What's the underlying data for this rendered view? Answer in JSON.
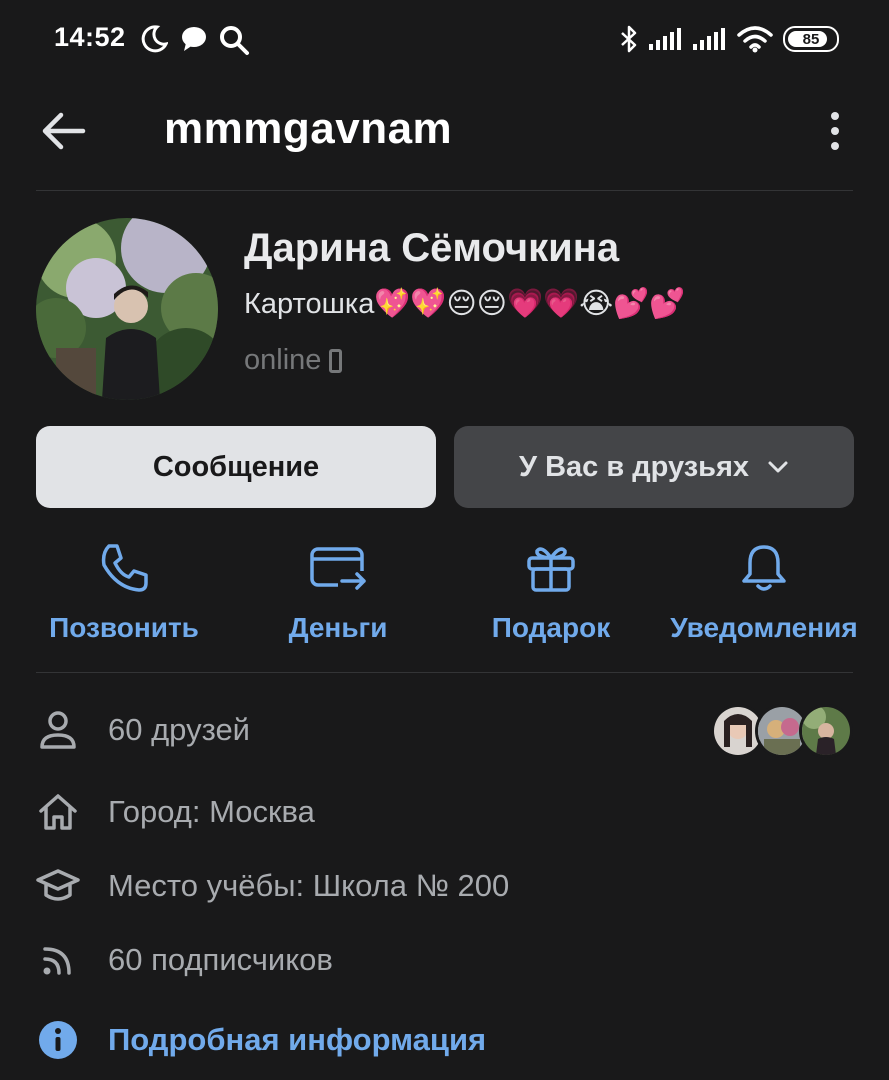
{
  "status_bar": {
    "time": "14:52",
    "battery": "85",
    "battery_level": 0.85,
    "icons": [
      "moon-icon",
      "message-icon",
      "search-icon",
      "bluetooth-icon",
      "signal-icon",
      "signal-icon",
      "wifi-icon",
      "battery-icon"
    ]
  },
  "header": {
    "title": "mmmgavnam"
  },
  "profile": {
    "name": "Дарина Сёмочкина",
    "status": "Картошка💖💖😔😔💗💗😭💕💕",
    "online": "online"
  },
  "buttons": {
    "message": "Сообщение",
    "friends": "У Вас в друзьях"
  },
  "actions": [
    {
      "label": "Позвонить",
      "icon": "phone-icon"
    },
    {
      "label": "Деньги",
      "icon": "money-transfer-icon"
    },
    {
      "label": "Подарок",
      "icon": "gift-icon"
    },
    {
      "label": "Уведомления",
      "icon": "bell-icon"
    }
  ],
  "info": {
    "friends": "60 друзей",
    "city": "Город: Москва",
    "education": "Место учёбы: Школа № 200",
    "followers": "60 подписчиков",
    "details": "Подробная информация"
  },
  "colors": {
    "background": "#19191a",
    "accent": "#71aaeb",
    "secondary_text": "#a8abaf",
    "button_light": "#e1e3e6",
    "button_dark": "#444548"
  }
}
